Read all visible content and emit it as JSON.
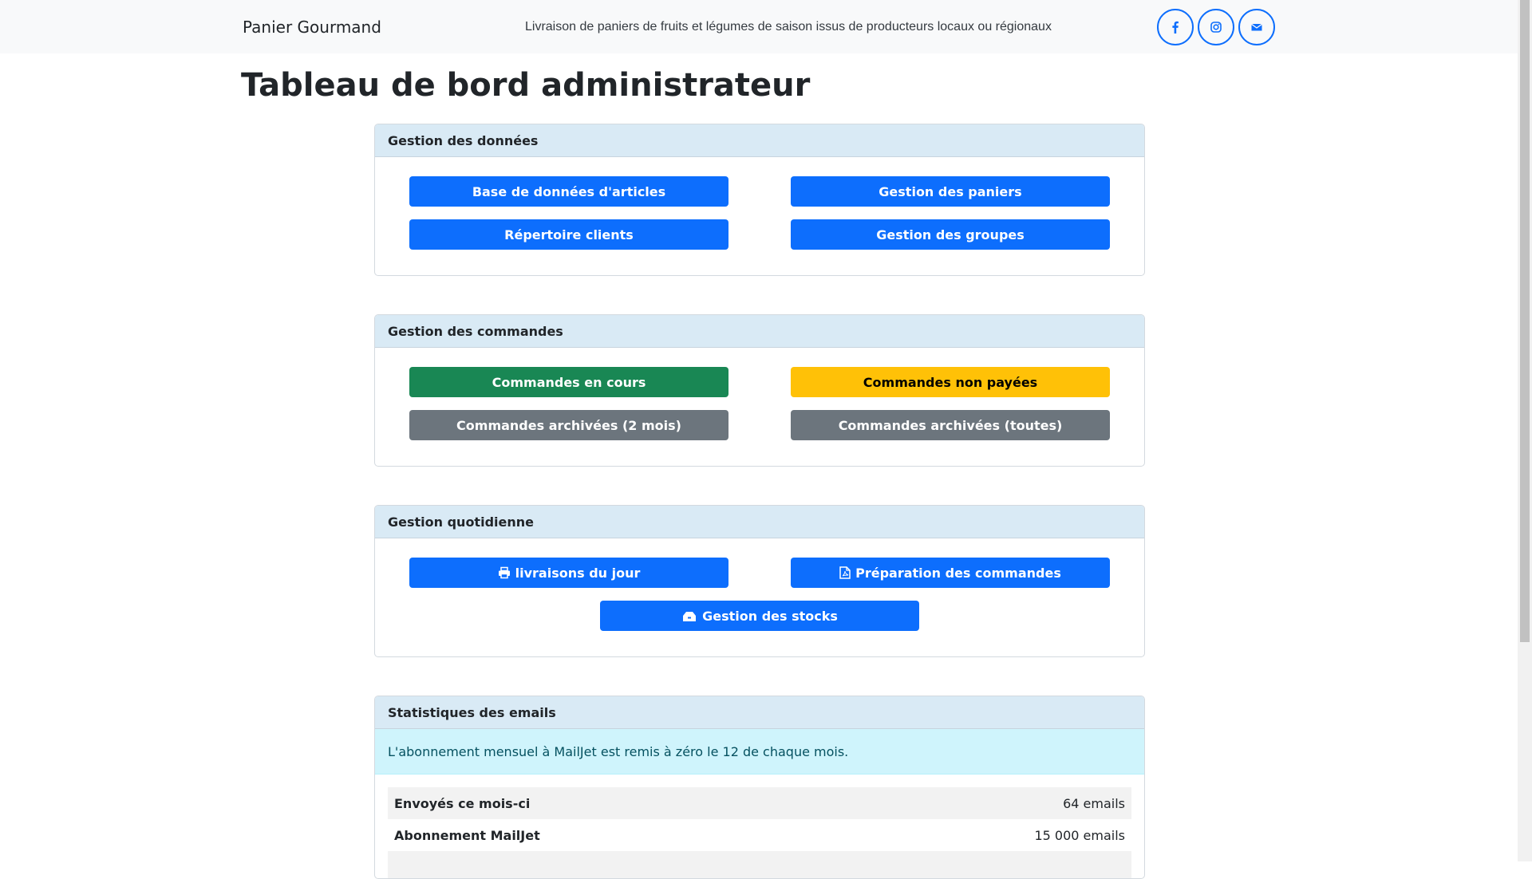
{
  "navbar": {
    "brand": "Panier Gourmand",
    "tagline": "Livraison de paniers de fruits et légumes de saison issus de producteurs locaux ou régionaux",
    "social_icons": [
      "facebook-icon",
      "instagram-icon",
      "envelope-icon"
    ]
  },
  "page": {
    "title": "Tableau de bord administrateur"
  },
  "sections": {
    "data": {
      "header": "Gestion des données",
      "buttons": {
        "articles": "Base de données d'articles",
        "paniers": "Gestion des paniers",
        "clients": "Répertoire clients",
        "groupes": "Gestion des groupes"
      }
    },
    "orders": {
      "header": "Gestion des commandes",
      "buttons": {
        "en_cours": "Commandes en cours",
        "non_payees": "Commandes non payées",
        "archivees_2mois": "Commandes archivées (2 mois)",
        "archivees_toutes": "Commandes archivées (toutes)"
      }
    },
    "daily": {
      "header": "Gestion quotidienne",
      "buttons": {
        "livraisons": "livraisons du jour",
        "preparation": "Préparation des commandes",
        "stocks": "Gestion des stocks"
      },
      "icons": [
        "printer-icon",
        "file-pdf-icon",
        "boxes-icon"
      ]
    },
    "emails": {
      "header": "Statistiques des emails",
      "alert": "L'abonnement mensuel à MailJet est remis à zéro le 12 de chaque mois.",
      "rows": [
        {
          "label": "Envoyés ce mois-ci",
          "value": "64 emails"
        },
        {
          "label": "Abonnement MailJet",
          "value": "15 000 emails"
        }
      ]
    }
  },
  "colors": {
    "primary": "#0d6efd",
    "success": "#198754",
    "warning": "#ffc107",
    "secondary": "#6c757d",
    "card_header": "#d9eaf5",
    "alert_bg": "#cff4fc"
  }
}
